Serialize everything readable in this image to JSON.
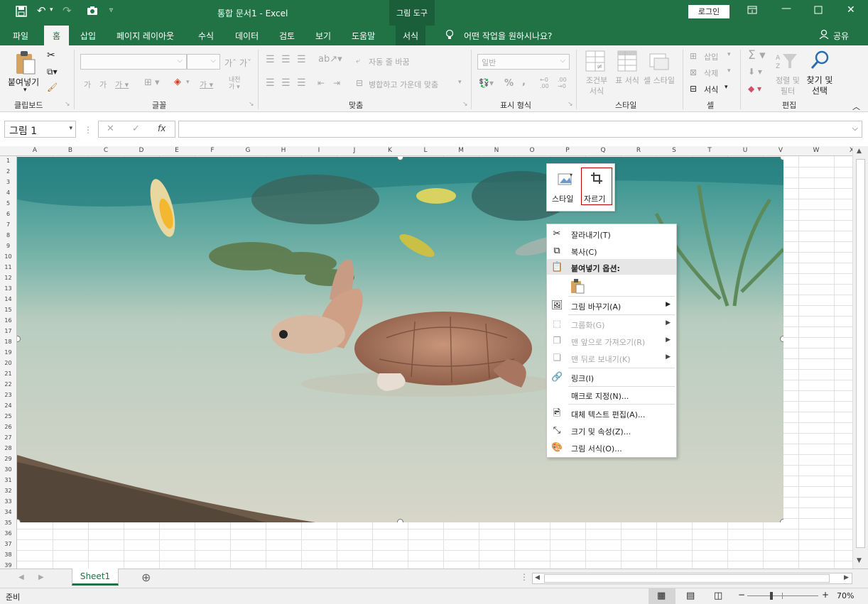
{
  "titlebar": {
    "title": "통합 문서1  -  Excel",
    "context_tool": "그림 도구",
    "login": "로그인"
  },
  "tabs": [
    "파일",
    "홈",
    "삽입",
    "페이지 레이아웃",
    "수식",
    "데이터",
    "검토",
    "보기",
    "도움말",
    "서식"
  ],
  "tell_me": "어떤 작업을 원하시나요?",
  "share": "공유",
  "ribbon": {
    "clipboard": {
      "paste": "붙여넣기",
      "label": "클립보드"
    },
    "font": {
      "label": "글꼴"
    },
    "alignment": {
      "wrap": "자동 줄 바꿈",
      "merge": "병합하고 가운데 맞춤",
      "label": "맞춤"
    },
    "number": {
      "format": "일반",
      "label": "표시 형식"
    },
    "styles": {
      "conditional": "조건부 서식",
      "table": "표 서식",
      "cell": "셀 스타일",
      "label": "스타일"
    },
    "cells": {
      "insert": "삽입",
      "delete": "삭제",
      "format": "서식",
      "label": "셀"
    },
    "editing": {
      "sort": "정렬 및 필터",
      "find": "찾기 및 선택",
      "label": "편집"
    }
  },
  "formula_bar": {
    "name_box": "그림 1",
    "formula": ""
  },
  "columns": [
    "A",
    "B",
    "C",
    "D",
    "E",
    "F",
    "G",
    "H",
    "I",
    "J",
    "K",
    "L",
    "M",
    "N",
    "O",
    "P",
    "Q",
    "R",
    "S",
    "T",
    "U",
    "V",
    "W",
    "X"
  ],
  "rows": [
    "1",
    "2",
    "3",
    "4",
    "5",
    "6",
    "7",
    "8",
    "9",
    "10",
    "11",
    "12",
    "13",
    "14",
    "15",
    "16",
    "17",
    "18",
    "19",
    "20",
    "21",
    "22",
    "23",
    "24",
    "25",
    "26",
    "27",
    "28",
    "29",
    "30",
    "31",
    "32",
    "33",
    "34",
    "35",
    "36",
    "37",
    "38",
    "39"
  ],
  "mini_toolbar": {
    "style": "스타일",
    "crop": "자르기"
  },
  "context_menu": {
    "cut": "잘라내기(T)",
    "copy": "복사(C)",
    "paste_options": "붙여넣기 옵션:",
    "change_picture": "그림 바꾸기(A)",
    "group": "그룹화(G)",
    "bring_front": "맨 앞으로 가져오기(R)",
    "send_back": "맨 뒤로 보내기(K)",
    "link": "링크(I)",
    "assign_macro": "매크로 지정(N)...",
    "alt_text": "대체 텍스트 편집(A)...",
    "size_props": "크기 및 속성(Z)...",
    "format_picture": "그림 서식(O)..."
  },
  "sheet_tab": "Sheet1",
  "status": {
    "ready": "준비",
    "zoom": "70%"
  },
  "colors": {
    "brand": "#217346",
    "accent_red": "#c00000"
  }
}
